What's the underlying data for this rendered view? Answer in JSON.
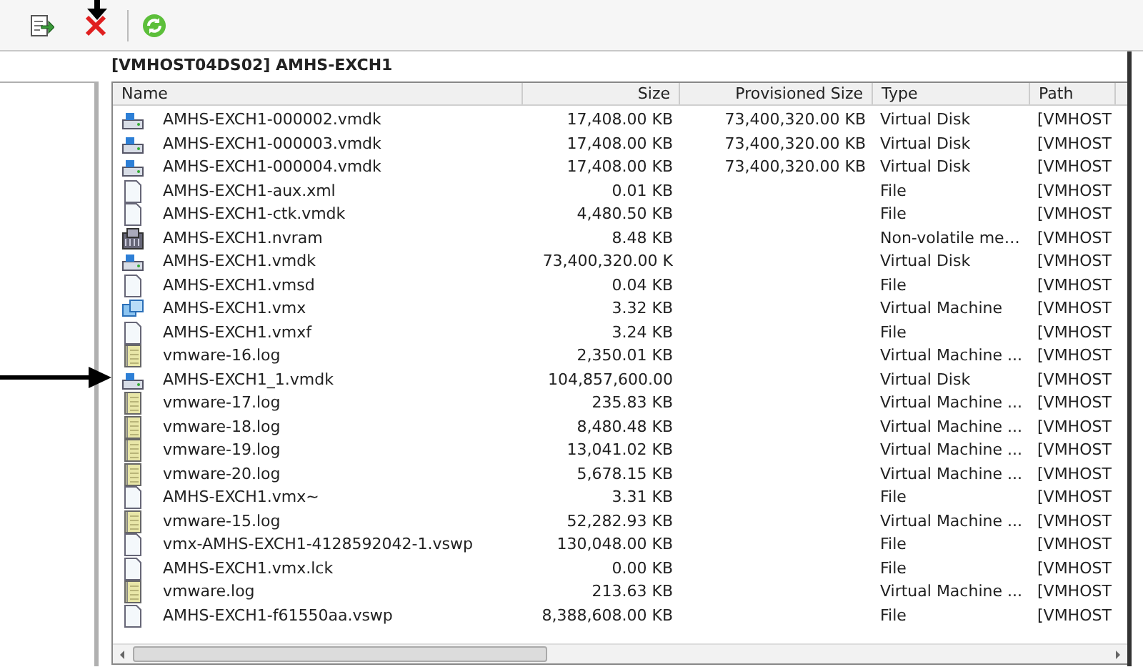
{
  "toolbar": {
    "buttons": [
      {
        "kind": "export"
      },
      {
        "kind": "delete"
      },
      {
        "kind": "refresh"
      }
    ]
  },
  "title": "[VMHOST04DS02] AMHS-EXCH1",
  "table": {
    "columns": [
      "Name",
      "Size",
      "Provisioned Size",
      "Type",
      "Path"
    ],
    "rows": [
      {
        "kind": "disk",
        "name": "AMHS-EXCH1-000002.vmdk",
        "size": "17,408.00 KB",
        "provisioned": "73,400,320.00 KB",
        "type": "Virtual Disk",
        "path": "[VMHOST"
      },
      {
        "kind": "disk",
        "name": "AMHS-EXCH1-000003.vmdk",
        "size": "17,408.00 KB",
        "provisioned": "73,400,320.00 KB",
        "type": "Virtual Disk",
        "path": "[VMHOST"
      },
      {
        "kind": "disk",
        "name": "AMHS-EXCH1-000004.vmdk",
        "size": "17,408.00 KB",
        "provisioned": "73,400,320.00 KB",
        "type": "Virtual Disk",
        "path": "[VMHOST"
      },
      {
        "kind": "file",
        "name": "AMHS-EXCH1-aux.xml",
        "size": "0.01 KB",
        "type": "File",
        "path": "[VMHOST"
      },
      {
        "kind": "file",
        "name": "AMHS-EXCH1-ctk.vmdk",
        "size": "4,480.50 KB",
        "type": "File",
        "path": "[VMHOST"
      },
      {
        "kind": "nvram",
        "name": "AMHS-EXCH1.nvram",
        "size": "8.48 KB",
        "type": "Non-volatile me…",
        "path": "[VMHOST"
      },
      {
        "kind": "disk",
        "name": "AMHS-EXCH1.vmdk",
        "size": "73,400,320.00 K",
        "type": "Virtual Disk",
        "path": "[VMHOST"
      },
      {
        "kind": "file",
        "name": "AMHS-EXCH1.vmsd",
        "size": "0.04 KB",
        "type": "File",
        "path": "[VMHOST"
      },
      {
        "kind": "vm",
        "name": "AMHS-EXCH1.vmx",
        "size": "3.32 KB",
        "type": "Virtual Machine",
        "path": "[VMHOST"
      },
      {
        "kind": "file",
        "name": "AMHS-EXCH1.vmxf",
        "size": "3.24 KB",
        "type": "File",
        "path": "[VMHOST"
      },
      {
        "kind": "log",
        "name": "vmware-16.log",
        "size": "2,350.01 KB",
        "type": "Virtual Machine ...",
        "path": "[VMHOST"
      },
      {
        "kind": "disk",
        "name": "AMHS-EXCH1_1.vmdk",
        "size": "104,857,600.00",
        "type": "Virtual Disk",
        "path": "[VMHOST"
      },
      {
        "kind": "log",
        "name": "vmware-17.log",
        "size": "235.83 KB",
        "type": "Virtual Machine ...",
        "path": "[VMHOST"
      },
      {
        "kind": "log",
        "name": "vmware-18.log",
        "size": "8,480.48 KB",
        "type": "Virtual Machine ...",
        "path": "[VMHOST"
      },
      {
        "kind": "log",
        "name": "vmware-19.log",
        "size": "13,041.02 KB",
        "type": "Virtual Machine ...",
        "path": "[VMHOST"
      },
      {
        "kind": "log",
        "name": "vmware-20.log",
        "size": "5,678.15 KB",
        "type": "Virtual Machine ...",
        "path": "[VMHOST"
      },
      {
        "kind": "file",
        "name": "AMHS-EXCH1.vmx~",
        "size": "3.31 KB",
        "type": "File",
        "path": "[VMHOST"
      },
      {
        "kind": "log",
        "name": "vmware-15.log",
        "size": "52,282.93 KB",
        "type": "Virtual Machine ...",
        "path": "[VMHOST"
      },
      {
        "kind": "file",
        "name": "vmx-AMHS-EXCH1-4128592042-1.vswp",
        "size": "130,048.00 KB",
        "type": "File",
        "path": "[VMHOST"
      },
      {
        "kind": "file",
        "name": "AMHS-EXCH1.vmx.lck",
        "size": "0.00 KB",
        "type": "File",
        "path": "[VMHOST"
      },
      {
        "kind": "log",
        "name": "vmware.log",
        "size": "213.63 KB",
        "type": "Virtual Machine ...",
        "path": "[VMHOST"
      },
      {
        "kind": "file",
        "name": "AMHS-EXCH1-f61550aa.vswp",
        "size": "8,388,608.00 KB",
        "type": "File",
        "path": "[VMHOST"
      }
    ]
  }
}
